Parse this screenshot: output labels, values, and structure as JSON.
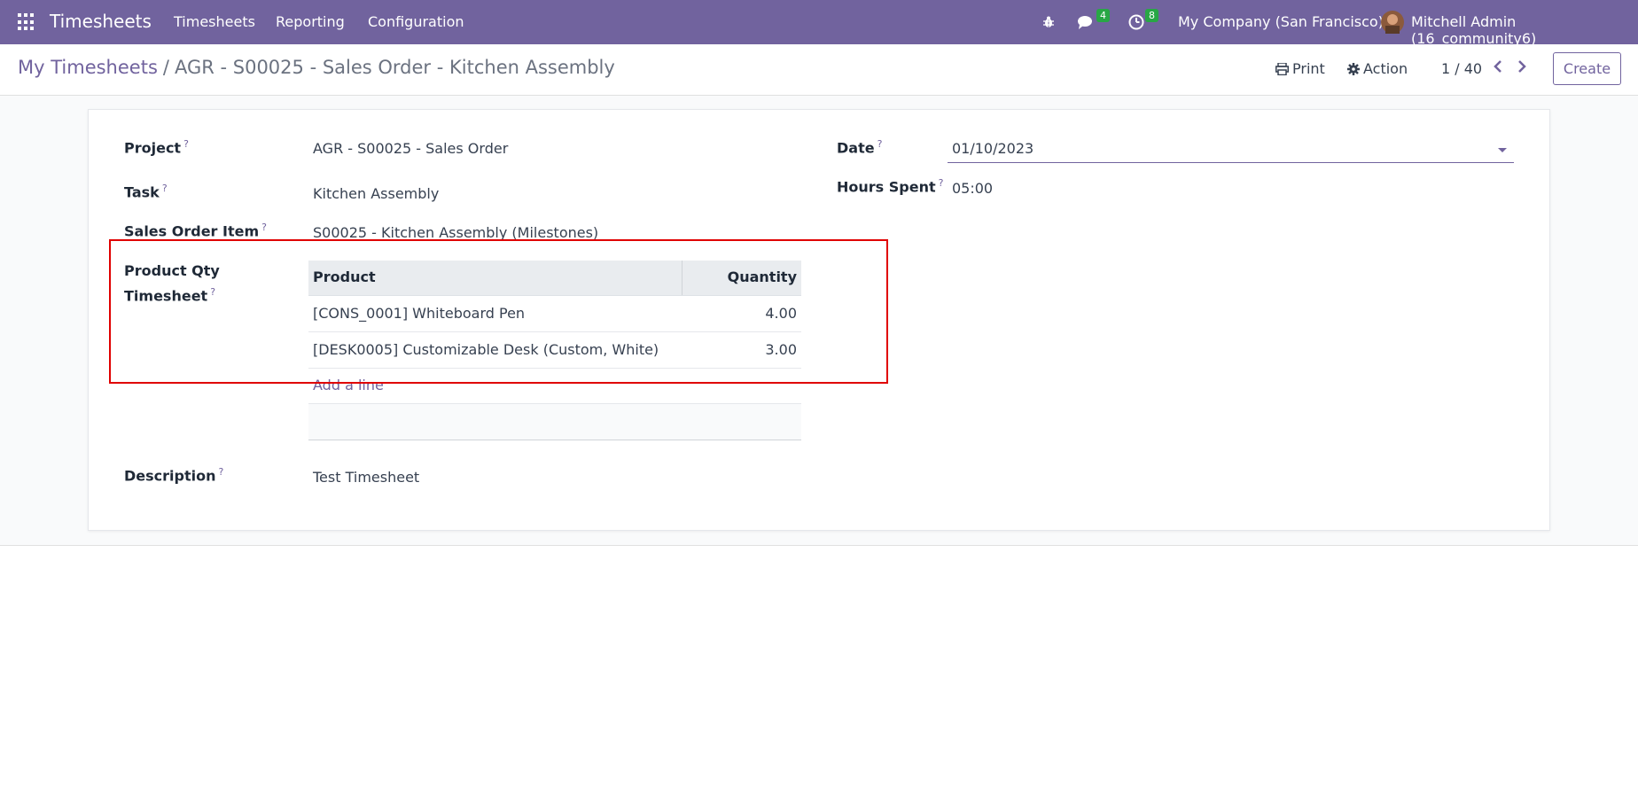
{
  "navbar": {
    "brand": "Timesheets",
    "menu": [
      "Timesheets",
      "Reporting",
      "Configuration"
    ],
    "messages_count": "4",
    "activities_count": "8",
    "company": "My Company (San Francisco)",
    "user": "Mitchell Admin (16_community6)"
  },
  "control": {
    "breadcrumb_parent": "My Timesheets",
    "breadcrumb_separator": "/",
    "breadcrumb_current": "AGR - S00025 - Sales Order - Kitchen Assembly",
    "print_label": "Print",
    "action_label": "Action",
    "pager": "1 / 40",
    "create_label": "Create"
  },
  "form": {
    "project_label": "Project",
    "project_value": "AGR - S00025 - Sales Order",
    "task_label": "Task",
    "task_value": "Kitchen Assembly",
    "so_item_label": "Sales Order Item",
    "so_item_value": "S00025 - Kitchen Assembly (Milestones)",
    "product_qty_label_1": "Product Qty",
    "product_qty_label_2": "Timesheet",
    "date_label": "Date",
    "date_value": "01/10/2023",
    "hours_label": "Hours Spent",
    "hours_value": "05:00",
    "description_label": "Description",
    "description_value": "Test Timesheet",
    "help_mark": "?"
  },
  "table": {
    "headers": {
      "product": "Product",
      "quantity": "Quantity"
    },
    "rows": [
      {
        "product": "[CONS_0001] Whiteboard Pen",
        "quantity": "4.00"
      },
      {
        "product": "[DESK0005] Customizable Desk (Custom, White)",
        "quantity": "3.00"
      }
    ],
    "add_line": "Add a line"
  },
  "colors": {
    "brand": "#71639e",
    "badge": "#28a745",
    "highlight": "#e00000"
  }
}
